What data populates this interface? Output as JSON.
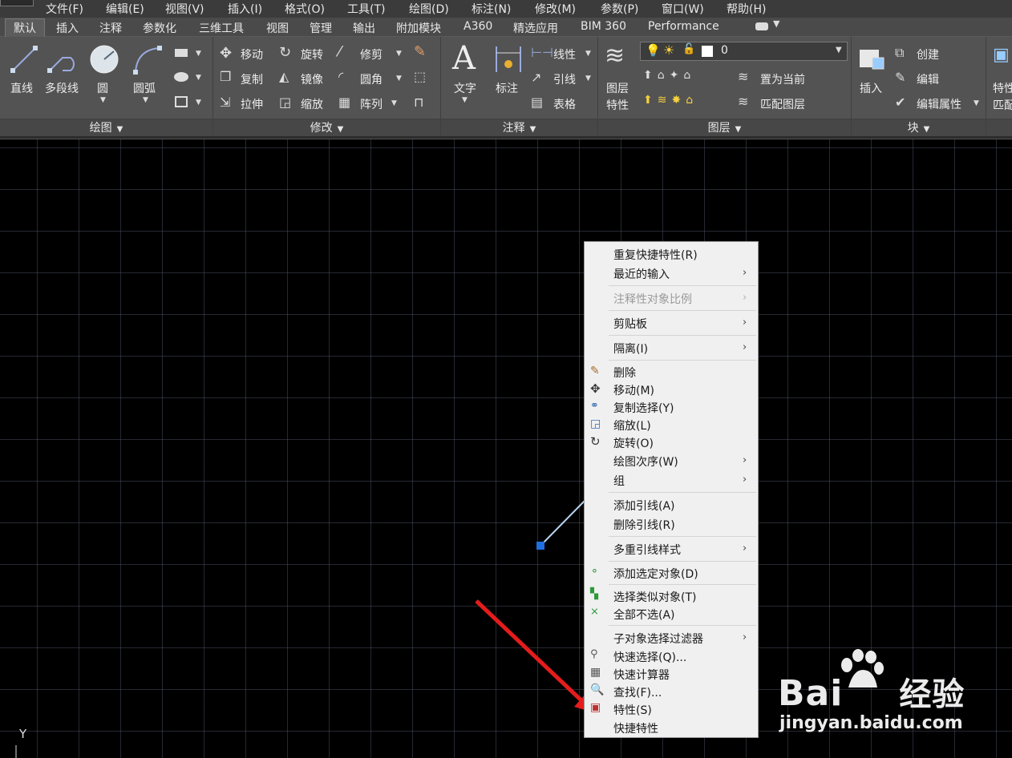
{
  "menubar": {
    "items": [
      "文件(F)",
      "编辑(E)",
      "视图(V)",
      "插入(I)",
      "格式(O)",
      "工具(T)",
      "绘图(D)",
      "标注(N)",
      "修改(M)",
      "参数(P)",
      "窗口(W)",
      "帮助(H)"
    ]
  },
  "tabs": [
    "默认",
    "插入",
    "注释",
    "参数化",
    "三维工具",
    "视图",
    "管理",
    "输出",
    "附加模块",
    "A360",
    "精选应用",
    "BIM 360",
    "Performance"
  ],
  "ribbon": {
    "draw": {
      "title": "绘图",
      "line": "直线",
      "polyline": "多段线",
      "circle": "圆",
      "arc": "圆弧"
    },
    "modify": {
      "title": "修改",
      "move": "移动",
      "rotate": "旋转",
      "trim": "修剪",
      "copy": "复制",
      "mirror": "镜像",
      "fillet": "圆角",
      "stretch": "拉伸",
      "scale": "缩放",
      "array": "阵列"
    },
    "annotation": {
      "title": "注释",
      "text": "文字",
      "dimension": "标注",
      "linear": "线性",
      "leader": "引线",
      "table": "表格"
    },
    "layers": {
      "title": "图层",
      "layer_props_1": "图层",
      "layer_props_2": "特性",
      "layer_value": "0",
      "make_current": "置为当前",
      "match_layer": "匹配图层"
    },
    "block": {
      "title": "块",
      "insert": "插入",
      "create": "创建",
      "edit": "编辑",
      "edit_attr": "编辑属性"
    },
    "props": {
      "label_1": "特性",
      "label_2": "匹配"
    }
  },
  "context_menu": {
    "items": [
      {
        "label": "重复快捷特性(R)"
      },
      {
        "label": "最近的输入"
      },
      {
        "label": "注释性对象比例"
      },
      {
        "label": "剪贴板"
      },
      {
        "label": "隔离(I)"
      },
      {
        "label": "删除"
      },
      {
        "label": "移动(M)"
      },
      {
        "label": "复制选择(Y)"
      },
      {
        "label": "缩放(L)"
      },
      {
        "label": "旋转(O)"
      },
      {
        "label": "绘图次序(W)"
      },
      {
        "label": "组"
      },
      {
        "label": "添加引线(A)"
      },
      {
        "label": "删除引线(R)"
      },
      {
        "label": "多重引线样式"
      },
      {
        "label": "添加选定对象(D)"
      },
      {
        "label": "选择类似对象(T)"
      },
      {
        "label": "全部不选(A)"
      },
      {
        "label": "子对象选择过滤器"
      },
      {
        "label": "快速选择(Q)..."
      },
      {
        "label": "快速计算器"
      },
      {
        "label": "查找(F)..."
      },
      {
        "label": "特性(S)"
      },
      {
        "label": "快捷特性"
      }
    ]
  },
  "canvas": {
    "axis_label": "Y"
  },
  "watermark": {
    "brand": "Bai",
    "brand_cn": "经验",
    "url": "jingyan.baidu.com"
  },
  "colors": {
    "menubar": "#3b3b3b",
    "ribbon": "#535353",
    "canvas": "#000000",
    "grip": "#1e6fe0",
    "arrow": "#e51c1c"
  }
}
